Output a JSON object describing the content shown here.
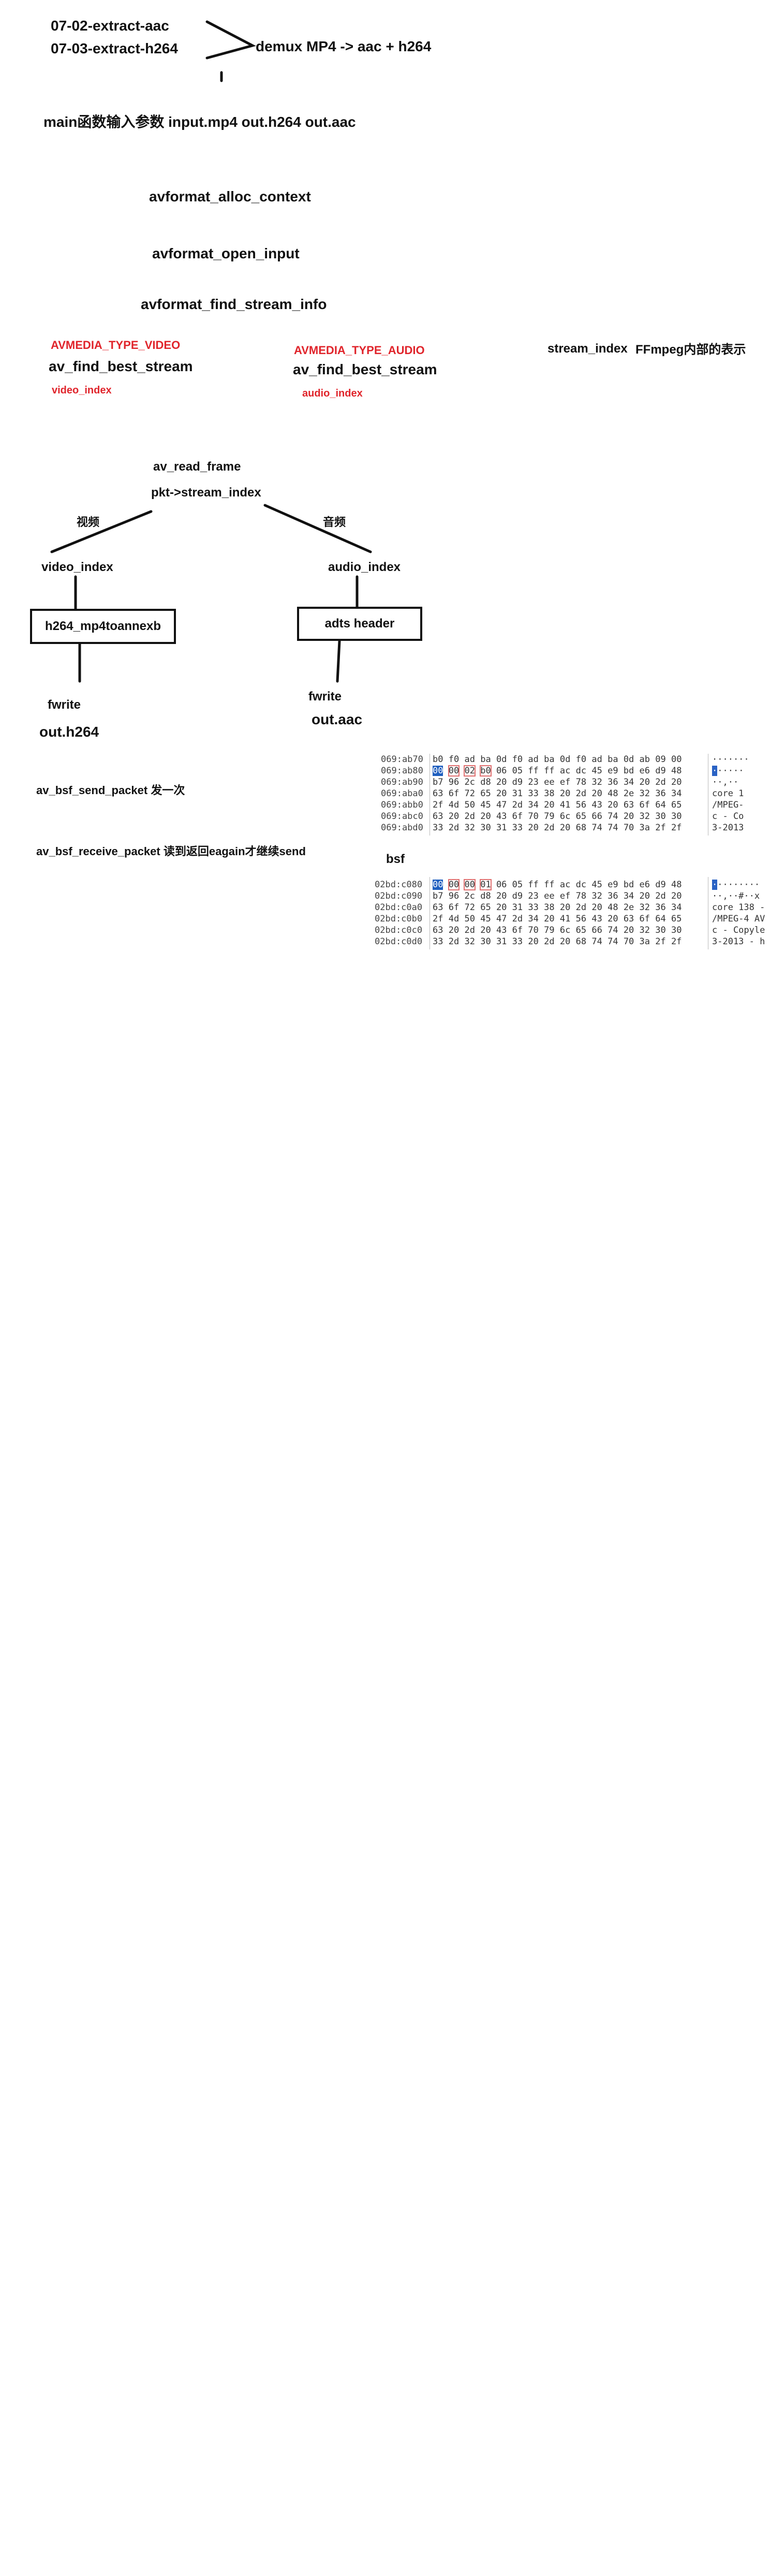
{
  "header": {
    "file1": "07-02-extract-aac",
    "file2": "07-03-extract-h264",
    "summary": "demux MP4 -> aac + h264"
  },
  "main_args": "main函数输入参数  input.mp4   out.h264 out.aac",
  "steps": {
    "alloc": "avformat_alloc_context",
    "open": "avformat_open_input",
    "find_info": "avformat_find_stream_info"
  },
  "video_stream": {
    "type": "AVMEDIA_TYPE_VIDEO",
    "func": "av_find_best_stream",
    "result": "video_index"
  },
  "audio_stream": {
    "type": "AVMEDIA_TYPE_AUDIO",
    "func": "av_find_best_stream",
    "result": "audio_index"
  },
  "stream_index_note": {
    "label": "stream_index",
    "desc": "FFmpeg内部的表示"
  },
  "read_loop": {
    "read": "av_read_frame",
    "pkt": "pkt->stream_index",
    "video_branch": "视频",
    "audio_branch": "音频",
    "video_index": "video_index",
    "audio_index": "audio_index",
    "video_box": "h264_mp4toannexb",
    "audio_box": "adts header",
    "video_write": "fwrite",
    "audio_write": "fwrite",
    "video_out": "out.h264",
    "audio_out": "out.aac"
  },
  "bsf_notes": {
    "send": "av_bsf_send_packet 发一次",
    "receive": "av_bsf_receive_packet 读到返回eagain才继续send",
    "bsf_label": "bsf"
  },
  "hex_before": {
    "rows": [
      {
        "addr": "069:ab70",
        "bytes": "b0 f0 ad ba 0d f0 ad ba 0d f0 ad ba 0d ab 09 00",
        "ascii": "·······"
      },
      {
        "addr": "069:ab80",
        "bytes": "00 00 02 b0 06 05 ff ff ac dc 45 e9 bd e6 d9 48",
        "ascii": "······"
      },
      {
        "addr": "069:ab90",
        "bytes": "b7 96 2c d8 20 d9 23 ee ef 78 32 36 34 20 2d 20",
        "ascii": "··,··"
      },
      {
        "addr": "069:aba0",
        "bytes": "63 6f 72 65 20 31 33 38 20 2d 20 48 2e 32 36 34",
        "ascii": "core 1"
      },
      {
        "addr": "069:abb0",
        "bytes": "2f 4d 50 45 47 2d 34 20 41 56 43 20 63 6f 64 65",
        "ascii": "/MPEG-"
      },
      {
        "addr": "069:abc0",
        "bytes": "63 20 2d 20 43 6f 70 79 6c 65 66 74 20 32 30 30",
        "ascii": "c - Co"
      },
      {
        "addr": "069:abd0",
        "bytes": "33 2d 32 30 31 33 20 2d 20 68 74 74 70 3a 2f 2f",
        "ascii": "3-2013"
      }
    ]
  },
  "hex_after": {
    "rows": [
      {
        "addr": "02bd:c080",
        "bytes": "00 00 00 01 06 05 ff ff ac dc 45 e9 bd e6 d9 48",
        "ascii": "·········"
      },
      {
        "addr": "02bd:c090",
        "bytes": "b7 96 2c d8 20 d9 23 ee ef 78 32 36 34 20 2d 20",
        "ascii": "··,··#··x"
      },
      {
        "addr": "02bd:c0a0",
        "bytes": "63 6f 72 65 20 31 33 38 20 2d 20 48 2e 32 36 34",
        "ascii": "core 138 -"
      },
      {
        "addr": "02bd:c0b0",
        "bytes": "2f 4d 50 45 47 2d 34 20 41 56 43 20 63 6f 64 65",
        "ascii": "/MPEG-4 AV"
      },
      {
        "addr": "02bd:c0c0",
        "bytes": "63 20 2d 20 43 6f 70 79 6c 65 66 74 20 32 30 30",
        "ascii": "c - Copyle"
      },
      {
        "addr": "02bd:c0d0",
        "bytes": "33 2d 32 30 31 33 20 2d 20 68 74 74 70 3a 2f 2f",
        "ascii": "3-2013 - h"
      }
    ]
  },
  "colors": {
    "red_label": "#e0242b",
    "hex_selection": "#1f5fbf"
  }
}
